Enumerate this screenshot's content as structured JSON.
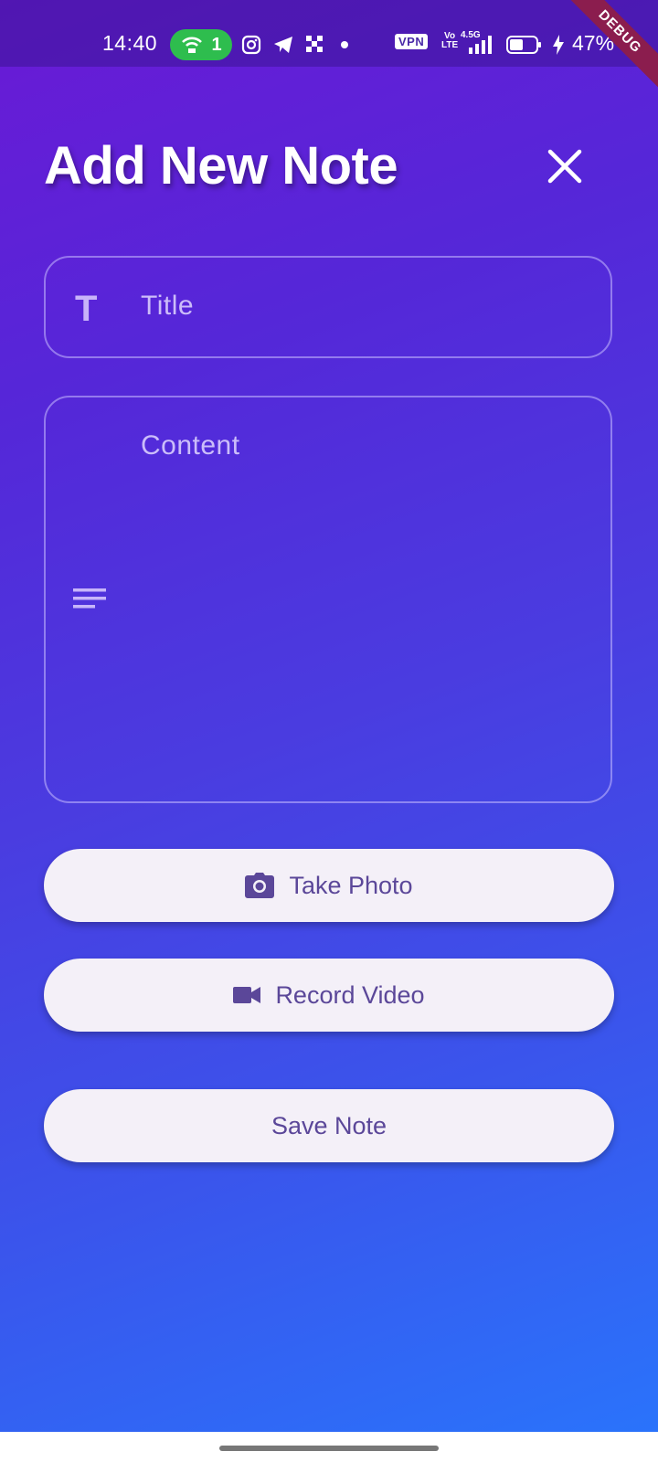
{
  "status_bar": {
    "time": "14:40",
    "hotspot_count": "1",
    "vpn": "VPN",
    "volte_top": "Vo",
    "volte_bottom": "LTE",
    "network": "4.5G",
    "battery": "47%",
    "icons": [
      "hotspot-icon",
      "instagram-icon",
      "telegram-icon",
      "app-icon",
      "dot-icon",
      "signal-icon",
      "battery-icon",
      "charging-icon"
    ]
  },
  "debug_banner": "DEBUG",
  "header": {
    "title": "Add New Note",
    "close_icon": "close-icon"
  },
  "form": {
    "title_placeholder": "Title",
    "title_icon": "T",
    "content_placeholder": "Content",
    "content_icon": "notes-icon"
  },
  "buttons": {
    "take_photo": "Take Photo",
    "record_video": "Record Video",
    "save_note": "Save Note"
  },
  "colors": {
    "gradient_top": "#6a1ad6",
    "gradient_bottom": "#2a73fb",
    "button_bg": "#f4f0f8",
    "button_text": "#5b4799",
    "hotspot_green": "#2ebd4e"
  }
}
